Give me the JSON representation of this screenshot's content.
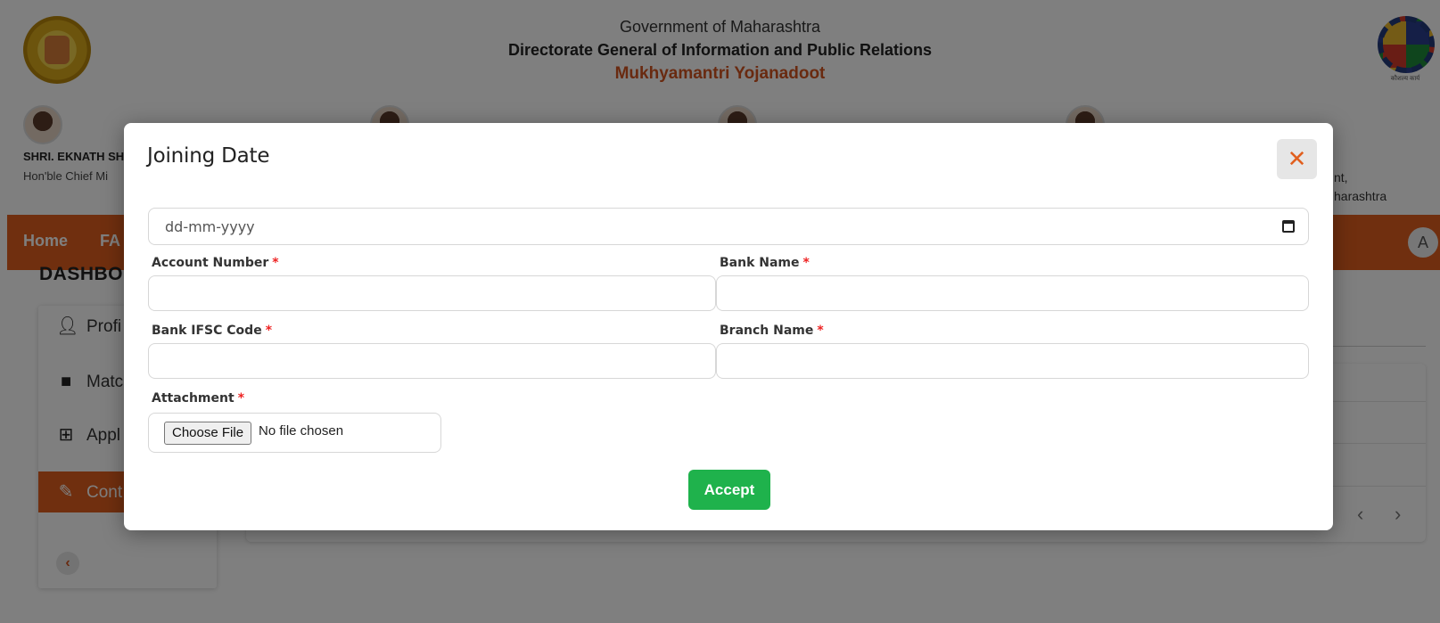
{
  "header": {
    "government": "Government of Maharashtra",
    "directorate": "Directorate General of Information and Public Relations",
    "scheme": "Mukhyamantri Yojanadoot",
    "right_emblem_caption": "कौशल्य कार्य"
  },
  "leaders": [
    {
      "name": "SHRI. EKNATH SH",
      "role": "Hon'ble Chief Mi"
    },
    {
      "name": "",
      "role": ""
    },
    {
      "name": "",
      "role": ""
    },
    {
      "name": "",
      "role": "",
      "role_tail_1": "nt,",
      "role_tail_2": "harashtra"
    }
  ],
  "nav": {
    "home": "Home",
    "faq": "FA",
    "avatar_initial": "A"
  },
  "dashboard": {
    "title": "DASHBO",
    "sidebar": [
      {
        "label": "Profi",
        "icon": "person-icon"
      },
      {
        "label": "Matc",
        "icon": "briefcase-icon"
      },
      {
        "label": "Appl",
        "icon": "apps-add-icon"
      },
      {
        "label": "Cont",
        "icon": "pencil-icon",
        "active": true
      }
    ],
    "collapse_glyph": "‹",
    "pagination": {
      "prev": "‹",
      "next": "›"
    }
  },
  "modal": {
    "title": "Joining Date",
    "close_glyph": "✕",
    "date_placeholder": "dd-mm-yyyy",
    "fields": {
      "account_number": {
        "label": "Account Number",
        "required": "*"
      },
      "bank_name": {
        "label": "Bank Name",
        "required": "*"
      },
      "ifsc": {
        "label": "Bank IFSC Code",
        "required": "*"
      },
      "branch_name": {
        "label": "Branch Name",
        "required": "*"
      },
      "attachment": {
        "label": "Attachment",
        "required": "*"
      }
    },
    "file_button": "Choose File",
    "file_status": "No file chosen",
    "accept": "Accept"
  },
  "colors": {
    "brand_orange": "#e15f1e",
    "accept_green": "#1fb24c",
    "required_red": "#e22222"
  }
}
